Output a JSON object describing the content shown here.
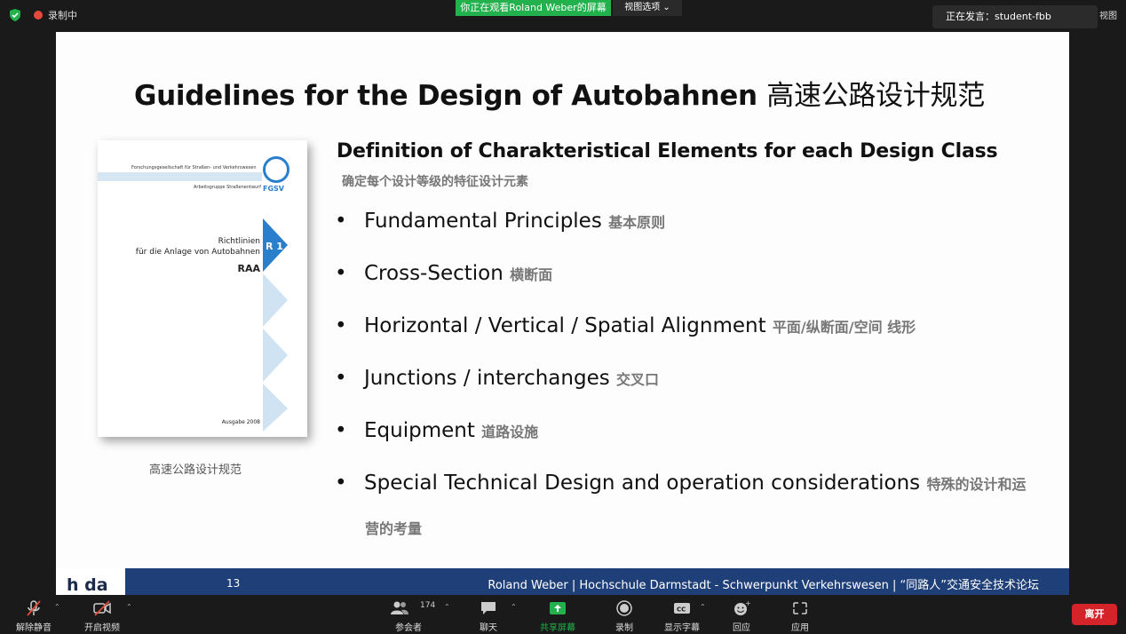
{
  "topbar": {
    "recording": "录制中",
    "viewing": "你正在观看Roland  Weber的屏幕",
    "view_options": "视图选项 ⌄",
    "speaker_label": "正在发言：student-fbb",
    "view_right": "视图"
  },
  "slide": {
    "title_en": "Guidelines for the Design of Autobahnen ",
    "title_cn": "高速公路设计规范",
    "cover": {
      "org": "Forschungsgesellschaft für Straßen- und Verkehrswesen",
      "group": "Arbeitsgruppe Straßenentwurf",
      "logo_text": "FGSV",
      "tag": "R 1",
      "title_line1": "Richtlinien",
      "title_line2": "für die Anlage von Autobahnen",
      "code": "RAA",
      "edition": "Ausgabe 2008"
    },
    "caption": "高速公路设计规范",
    "subtitle": "Definition of Charakteristical Elements for each Design Class",
    "subtitle_cn": "确定每个设计等级的特征设计元素",
    "bullets": [
      {
        "en": "Fundamental Principles ",
        "cn": "基本原则"
      },
      {
        "en": "Cross-Section ",
        "cn": "横断面"
      },
      {
        "en": "Horizontal / Vertical / Spatial Alignment ",
        "cn": "平面/纵断面/空间 线形"
      },
      {
        "en": "Junctions / interchanges ",
        "cn": "交叉口"
      },
      {
        "en": "Equipment ",
        "cn": "道路设施"
      },
      {
        "en": "Special Technical Design and operation considerations ",
        "cn": "特殊的设计和运"
      }
    ],
    "bullet6_cn_line2": "营的考量",
    "footer": {
      "logo": "h da",
      "page": "13",
      "text": "Roland Weber | Hochschule Darmstadt - Schwerpunkt Verkehrswesen | “同路人”交通安全技术论坛"
    }
  },
  "toolbar": {
    "unmute": "解除静音",
    "video": "开启视频",
    "participants": "参会者",
    "participants_count": "174",
    "chat": "聊天",
    "share": "共享屏幕",
    "record": "录制",
    "captions": "显示字幕",
    "reactions": "回应",
    "apps": "应用",
    "leave": "离开"
  },
  "colors": {
    "viewing_bar": "#23b14d",
    "footer_band": "#1f3f78",
    "leave_button": "#d4242a",
    "cover_blue": "#2a7fcc"
  }
}
